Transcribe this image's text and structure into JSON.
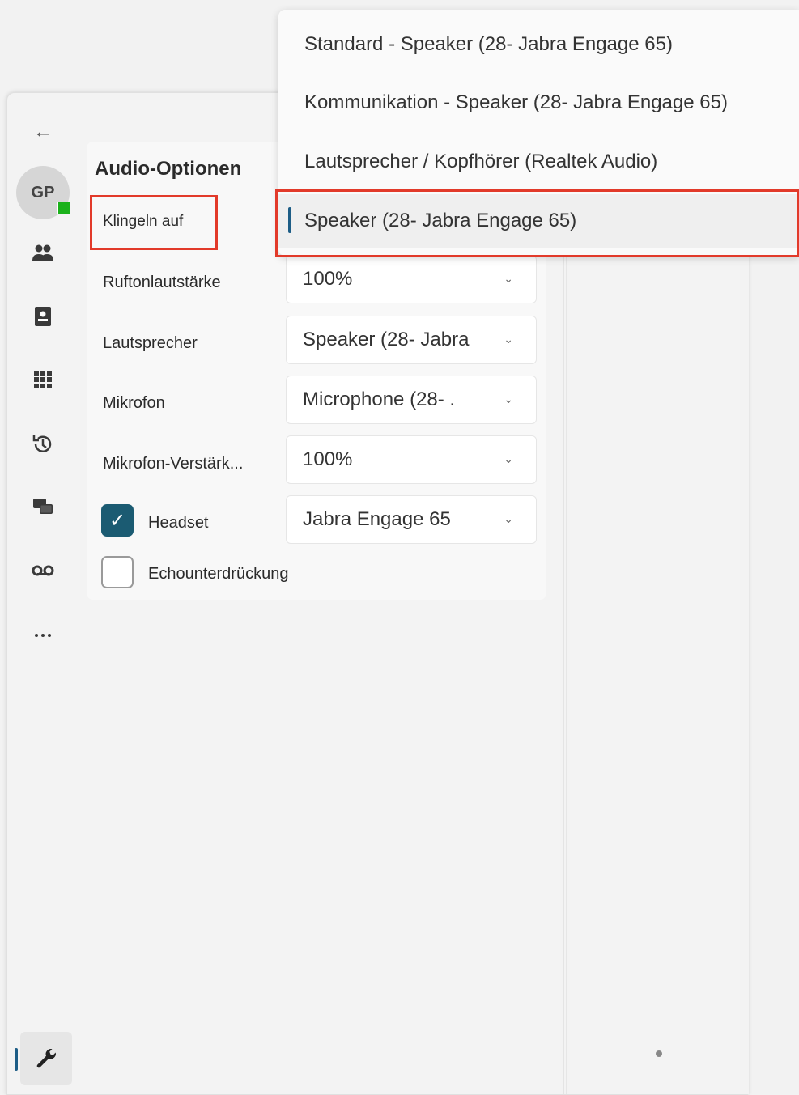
{
  "sidebar": {
    "avatar_initials": "GP",
    "presence_color": "#1bb11b",
    "icons": [
      "back-arrow-icon",
      "people-icon",
      "contact-card-icon",
      "dialpad-icon",
      "history-icon",
      "chat-icon",
      "voicemail-icon",
      "more-icon",
      "wrench-icon"
    ]
  },
  "audio": {
    "title": "Audio-Optionen",
    "ring_on_label": "Klingeln auf",
    "ringtone_volume_label": "Ruftonlautstärke",
    "ringtone_volume_value": "100%",
    "speaker_label": "Lautsprecher",
    "speaker_value": "Speaker (28- Jabra",
    "microphone_label": "Mikrofon",
    "microphone_value": "Microphone (28- .",
    "mic_gain_label": "Mikrofon-Verstärk...",
    "mic_gain_value": "100%",
    "headset_label": "Headset",
    "headset_checked": true,
    "headset_value": "Jabra Engage 65",
    "echo_label": "Echounterdrückung",
    "echo_checked": false
  },
  "dropdown_menu": {
    "items": [
      "Standard - Speaker (28- Jabra Engage 65)",
      "Kommunikation - Speaker (28- Jabra Engage 65)",
      "Lautsprecher / Kopfhörer (Realtek Audio)",
      "Speaker (28- Jabra Engage 65)"
    ],
    "selected": "Speaker (28- Jabra Engage 65)"
  },
  "colors": {
    "accent": "#1d5d86",
    "highlight": "#e23a2a",
    "checkbox": "#1b5b72"
  }
}
